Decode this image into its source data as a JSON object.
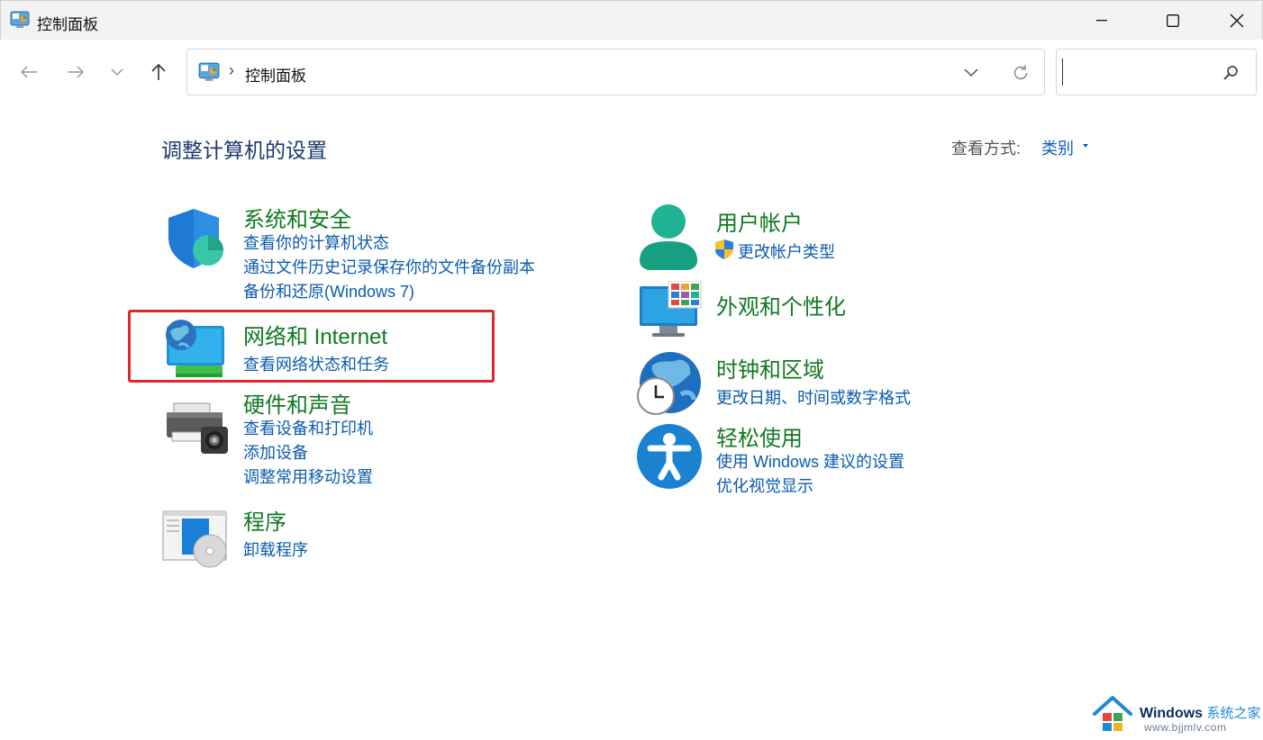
{
  "window": {
    "title": "控制面板"
  },
  "nav": {
    "address_path": "控制面板",
    "address_separator": "›",
    "search_placeholder": ""
  },
  "main": {
    "heading": "调整计算机的设置",
    "view_by_label": "查看方式:",
    "view_by_value": "类别"
  },
  "categories": [
    {
      "title": "系统和安全",
      "icon": "shield-icon",
      "links": [
        "查看你的计算机状态",
        "通过文件历史记录保存你的文件备份副本",
        "备份和还原(Windows 7)"
      ]
    },
    {
      "title": "网络和 Internet",
      "icon": "network-globe-icon",
      "links": [
        "查看网络状态和任务"
      ],
      "highlighted": true
    },
    {
      "title": "硬件和声音",
      "icon": "printer-icon",
      "links": [
        "查看设备和打印机",
        "添加设备",
        "调整常用移动设置"
      ]
    },
    {
      "title": "程序",
      "icon": "programs-icon",
      "links": [
        "卸载程序"
      ]
    },
    {
      "title": "用户帐户",
      "icon": "user-icon",
      "links": [
        "更改帐户类型"
      ],
      "link_icon": "uac-shield-icon"
    },
    {
      "title": "外观和个性化",
      "icon": "monitor-appearance-icon",
      "links": []
    },
    {
      "title": "时钟和区域",
      "icon": "clock-globe-icon",
      "links": [
        "更改日期、时间或数字格式"
      ]
    },
    {
      "title": "轻松使用",
      "icon": "accessibility-icon",
      "links": [
        "使用 Windows 建议的设置",
        "优化视觉显示"
      ]
    }
  ],
  "watermark": {
    "brand": "Windows",
    "brand_suffix": "系统之家",
    "url": "www.bjjmlv.com"
  },
  "colors": {
    "category_title": "#117a20",
    "link": "#0b5cad",
    "heading": "#1e3a6e",
    "highlight_border": "#e3262a"
  }
}
